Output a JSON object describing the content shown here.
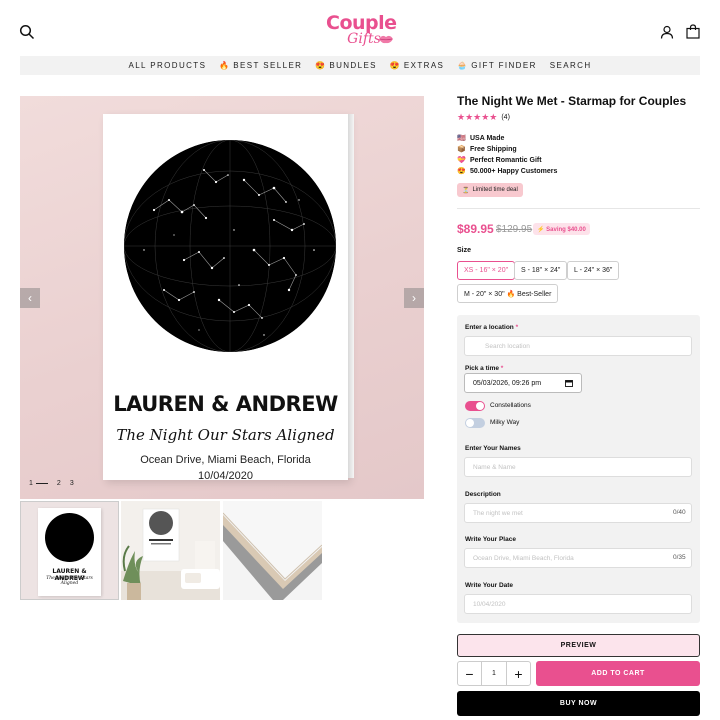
{
  "header": {
    "logo_line1": "Couple",
    "logo_line2": "Gifts",
    "search_icon": "search-icon",
    "account_icon": "user-icon",
    "cart_icon": "cart-icon"
  },
  "nav": {
    "items": [
      {
        "label": "ALL PRODUCTS",
        "emoji": ""
      },
      {
        "label": "BEST SELLER",
        "emoji": "🔥"
      },
      {
        "label": "BUNDLES",
        "emoji": "😍"
      },
      {
        "label": "EXTRAS",
        "emoji": "😍"
      },
      {
        "label": "GIFT FINDER",
        "emoji": "🧁"
      },
      {
        "label": "SEARCH",
        "emoji": ""
      }
    ]
  },
  "gallery": {
    "poster": {
      "names": "LAUREN & ANDREW",
      "title": "The Night Our Stars Aligned",
      "place": "Ocean Drive, Miami Beach, Florida",
      "date": "10/04/2020"
    },
    "thumb_poster": {
      "names": "LAUREN & ANDREW",
      "title": "The Night Our Stars Aligned"
    },
    "prev_arrow": "‹",
    "next_arrow": "›",
    "pages": [
      "1",
      "2",
      "3"
    ]
  },
  "product": {
    "title": "The Night We Met - Starmap for Couples",
    "rating_stars": "★★★★★",
    "review_count": "(4)",
    "features": [
      {
        "icon": "🇺🇸",
        "label": "USA Made"
      },
      {
        "icon": "📦",
        "label": "Free Shipping"
      },
      {
        "icon": "💝",
        "label": "Perfect Romantic Gift"
      },
      {
        "icon": "😍",
        "label": "50.000+ Happy Customers"
      }
    ],
    "deal_icon": "⏳",
    "deal_label": "Limited time deal",
    "price": "$89.95",
    "compare_price": "$129.95",
    "saving_label": "⚡ Saving $40.00",
    "size_label": "Size",
    "sizes": [
      "XS - 16\" × 20\"",
      "S - 18\" × 24\"",
      "L - 24\" × 36\"",
      "M - 20\" × 30\" 🔥 Best-Seller"
    ],
    "selected_size": "XS - 16\" × 20\""
  },
  "form": {
    "location_label": "Enter a location",
    "location_placeholder": "Search location",
    "time_label": "Pick a time",
    "time_value": "05/03/2026, 09:26 pm",
    "constellations_label": "Constellations",
    "constellations_on": true,
    "milkyway_label": "Milky Way",
    "milkyway_on": false,
    "names_label": "Enter Your Names",
    "names_placeholder": "Name & Name",
    "description_label": "Description",
    "description_placeholder": "The night we met",
    "description_counter": "0/40",
    "place_label": "Write Your Place",
    "place_placeholder": "Ocean Drive, Miami Beach, Florida",
    "place_counter": "0/35",
    "date_label": "Write Your Date",
    "date_placeholder": "10/04/2020",
    "required_mark": "*"
  },
  "actions": {
    "preview_label": "PREVIEW",
    "minus": "−",
    "quantity": "1",
    "plus": "+",
    "add_to_cart_label": "ADD TO CART",
    "buy_now_label": "BUY NOW"
  },
  "colors": {
    "accent": "#e9508f",
    "preview_bg": "#fce4ec",
    "buy_bg": "#000000"
  }
}
